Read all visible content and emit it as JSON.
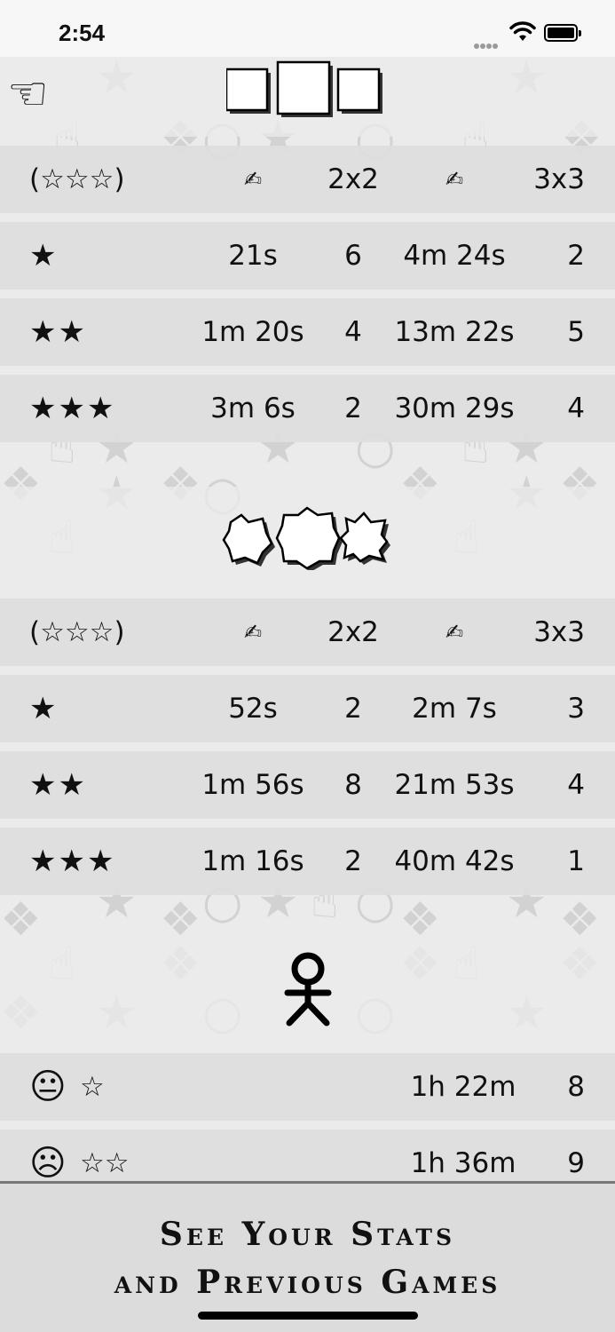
{
  "status_bar": {
    "time": "2:54"
  },
  "square_section": {
    "header": {
      "label": "(☆☆☆)",
      "col2x2": "2x2",
      "col3x3": "3x3"
    },
    "rows": [
      {
        "stars": "★",
        "t2": "21s",
        "n2": "6",
        "t3": "4m 24s",
        "n3": "2"
      },
      {
        "stars": "★★",
        "t2": "1m 20s",
        "n2": "4",
        "t3": "13m 22s",
        "n3": "5"
      },
      {
        "stars": "★★★",
        "t2": "3m 6s",
        "n2": "2",
        "t3": "30m 29s",
        "n3": "4"
      }
    ]
  },
  "jagged_section": {
    "header": {
      "label": "(☆☆☆)",
      "col2x2": "2x2",
      "col3x3": "3x3"
    },
    "rows": [
      {
        "stars": "★",
        "t2": "52s",
        "n2": "2",
        "t3": "2m 7s",
        "n3": "3"
      },
      {
        "stars": "★★",
        "t2": "1m 56s",
        "n2": "8",
        "t3": "21m 53s",
        "n3": "4"
      },
      {
        "stars": "★★★",
        "t2": "1m 16s",
        "n2": "2",
        "t3": "40m 42s",
        "n3": "1"
      }
    ]
  },
  "figure_section": {
    "rows": [
      {
        "face": "😐",
        "stars": "☆",
        "time": "1h 22m",
        "count": "8"
      },
      {
        "face": "☹",
        "stars": "☆☆",
        "time": "1h 36m",
        "count": "9"
      }
    ]
  },
  "banner": {
    "line1": "See Your Stats",
    "line2": "and Previous Games"
  },
  "icons": {
    "pointer": "pointing-hand-icon",
    "edit": "writing-hand-icon",
    "square_tiles": "square-tiles-icon",
    "jagged_tiles": "jagged-tiles-icon",
    "stick_figure": "stick-figure-icon"
  }
}
